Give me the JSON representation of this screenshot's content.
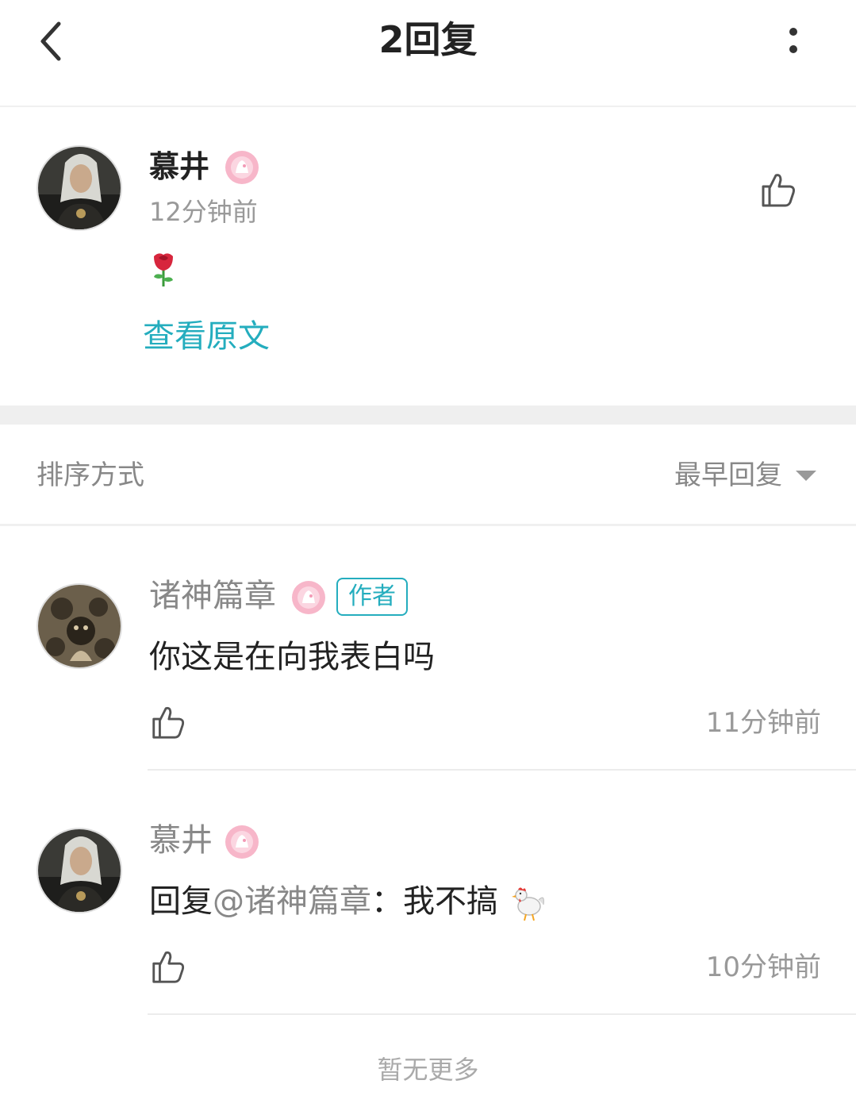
{
  "header": {
    "title": "2回复"
  },
  "main_post": {
    "author": "慕井",
    "time": "12分钟前",
    "content_emoji": "rose",
    "view_original_label": "查看原文"
  },
  "sort": {
    "label": "排序方式",
    "value": "最早回复"
  },
  "replies": [
    {
      "author": "诸神篇章",
      "author_tag": "作者",
      "text": "你这是在向我表白吗",
      "time": "11分钟前"
    },
    {
      "author": "慕井",
      "text_prefix": "回复",
      "mention": "@诸神篇章",
      "text_body": "：我不搞",
      "text_emoji": "rooster",
      "time": "10分钟前"
    }
  ],
  "footer": {
    "no_more": "暂无更多"
  },
  "icons": {
    "back": "chevron-left-icon",
    "more": "more-vertical-icon",
    "like": "thumbs-up-icon",
    "badge": "anniversary-2022-badge"
  },
  "colors": {
    "accent": "#24adbe",
    "muted_text": "#999999",
    "badge_pink": "#f7b6c9"
  }
}
